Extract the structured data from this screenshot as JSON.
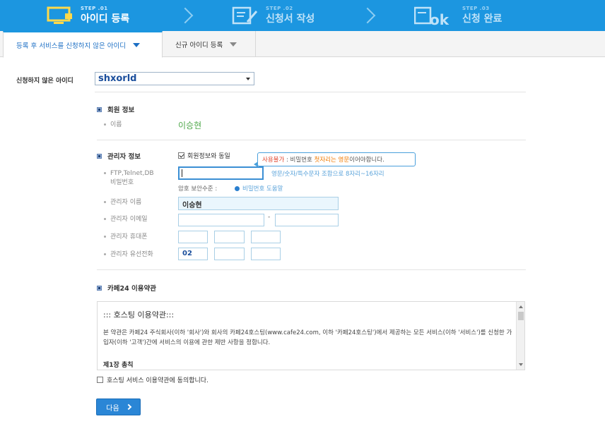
{
  "steps": [
    {
      "num": "STEP .01",
      "title": "아이디 등록",
      "icon": "monitor-icon"
    },
    {
      "num": "STEP .02",
      "title": "신청서 작성",
      "icon": "form-edit-icon"
    },
    {
      "num": "STEP .03",
      "title": "신청 완료",
      "icon": "ok-icon"
    }
  ],
  "tabs": [
    {
      "label": "등록 후 서비스를 신청하지 않은 아이디"
    },
    {
      "label": "신규 아이디 등록"
    }
  ],
  "unregistered": {
    "label": "신청하지 않은 아이디",
    "value": "shxorld"
  },
  "member": {
    "title": "회원 정보",
    "name_label": "이름",
    "name_value": "이승현"
  },
  "admin": {
    "title": "관리자 정보",
    "same_label": "회원정보와 동일",
    "tooltip_red": "사용불가",
    "tooltip_mid": " : 비밀번호 ",
    "tooltip_orange": "첫자리는 영문",
    "tooltip_end": "이어야합니다.",
    "pw_label_1": "FTP,Telnet,DB",
    "pw_label_2": "비밀번호",
    "pw_hint": "영문/숫자/특수문자 조합으로 8자리~16자리",
    "pw_level_label": "암호 보안수준 :",
    "pw_help": "비밀번호 도움말",
    "name_label": "관리자 이름",
    "name_value": "이승현",
    "email_label": "관리자 이메일",
    "email_sep": "-",
    "mobile_label": "관리자 휴대폰",
    "phone_label": "관리자 유선전화",
    "phone_area": "02"
  },
  "terms": {
    "title": "카페24 이용약관",
    "heading": "::: 호스팅 이용약관:::",
    "body": "본 약관은 카페24 주식회사(이하 '회사')와 회사의 카페24호스팅(www.cafe24.com, 이하 '카페24호스팅')에서 제공하는 모든 서비스(이하 '서비스')를 신청한 가입자(이하 '고객')간에 서비스의 이용에 관한 제반 사항을 정합니다.",
    "chapter": "제1장 총칙",
    "agree_label": "호스팅 서비스 이용약관에 동의합니다."
  },
  "next_button": "다음",
  "colors": {
    "accent": "#1c96e0",
    "button": "#2a86d6",
    "name_green": "#4fa84a",
    "warning_red": "#e0452c"
  }
}
